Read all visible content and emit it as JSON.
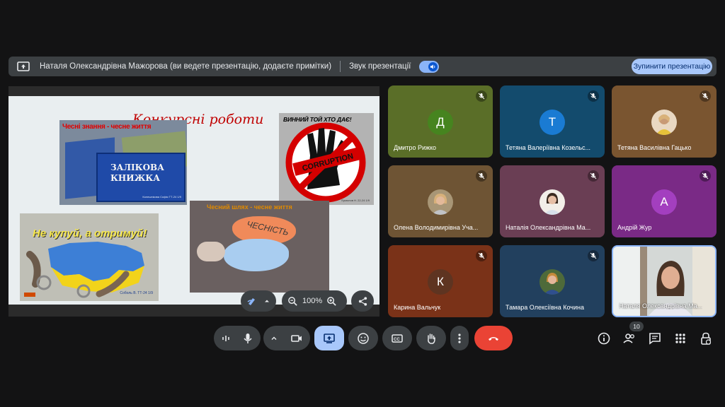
{
  "banner": {
    "presenter_text": "Наталя Олександрівна Мажорова (ви ведете презентацію, додаєте примітки)",
    "sound_label": "Звук презентації",
    "stop_label": "Зупинити презентацію"
  },
  "slide": {
    "title": "Конкурсні роботи",
    "card1_caption": "Чесні знання - чесне життя",
    "card1_book_text": "ЗАЛІКОВА КНИЖКА",
    "card1_sign": "Колешнікова Софія ТТ-24 1/9",
    "card2_text": "ВИННИЙ ТОЙ ХТО ДАЄ!",
    "card2_word": "CORRUPTION",
    "card2_sign": "Ермолов Н. 22-24 1/9",
    "card3_caption": "Не купуй, а отримуй!",
    "card3_sign": "Соболь В. ТТ-24 1/9",
    "card4_caption": "Чесний шлях - чесне життя",
    "card4_word": "ЧЕСНІСТЬ"
  },
  "controls": {
    "zoom": "100%"
  },
  "participants": [
    {
      "name": "Дмитро Рижко",
      "initial": "Д",
      "avatar_color": "#46841f"
    },
    {
      "name": "Тетяна Валеріївна Козельс...",
      "initial": "Т",
      "avatar_color": "#1a7bd3"
    },
    {
      "name": "Тетяна Василівна Гацько",
      "initial": ""
    },
    {
      "name": "Олена Володимирівна Уча...",
      "initial": ""
    },
    {
      "name": "Наталія Олександрівна Ма...",
      "initial": ""
    },
    {
      "name": "Андрій Жур",
      "initial": "А",
      "avatar_color": "#a33fbf"
    },
    {
      "name": "Карина Вальчук",
      "initial": "К",
      "avatar_color": "#5e3421"
    },
    {
      "name": "Тамара Олексіївна Кочина",
      "initial": ""
    },
    {
      "name": "Наталя Олександрівна Ма...",
      "initial": ""
    }
  ],
  "toolbar": {
    "people_count": "10",
    "end_call_color": "#ea4335",
    "present_color": "#a8c7fa"
  }
}
